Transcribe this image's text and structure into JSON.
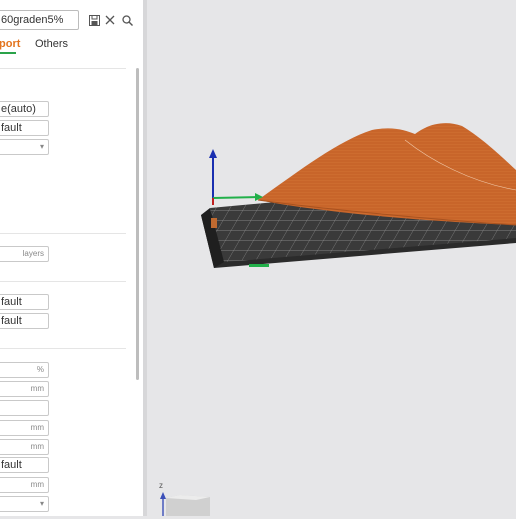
{
  "preset": {
    "value": "60graden5%"
  },
  "toolbar": {
    "save_icon": "save-icon",
    "close_icon": "close-icon",
    "search_icon": "search-icon"
  },
  "tabs": [
    {
      "label": "port",
      "active": true
    },
    {
      "label": "Others",
      "active": false
    }
  ],
  "fields": [
    {
      "value": "e(auto)",
      "unit": ""
    },
    {
      "value": "fault",
      "unit": ""
    },
    {
      "value": "",
      "unit": "▾"
    },
    {
      "value": "",
      "unit": "layers"
    },
    {
      "value": "fault",
      "unit": ""
    },
    {
      "value": "fault",
      "unit": ""
    },
    {
      "value": "",
      "unit": "%"
    },
    {
      "value": "",
      "unit": "mm"
    },
    {
      "value": "",
      "unit": ""
    },
    {
      "value": "",
      "unit": "mm"
    },
    {
      "value": "",
      "unit": "mm"
    },
    {
      "value": "fault",
      "unit": ""
    },
    {
      "value": "",
      "unit": "mm"
    },
    {
      "value": "",
      "unit": "▾"
    }
  ],
  "viewport": {
    "axis_z_label": "z",
    "accent": "#e3741e",
    "model_color": "#c8652a"
  }
}
